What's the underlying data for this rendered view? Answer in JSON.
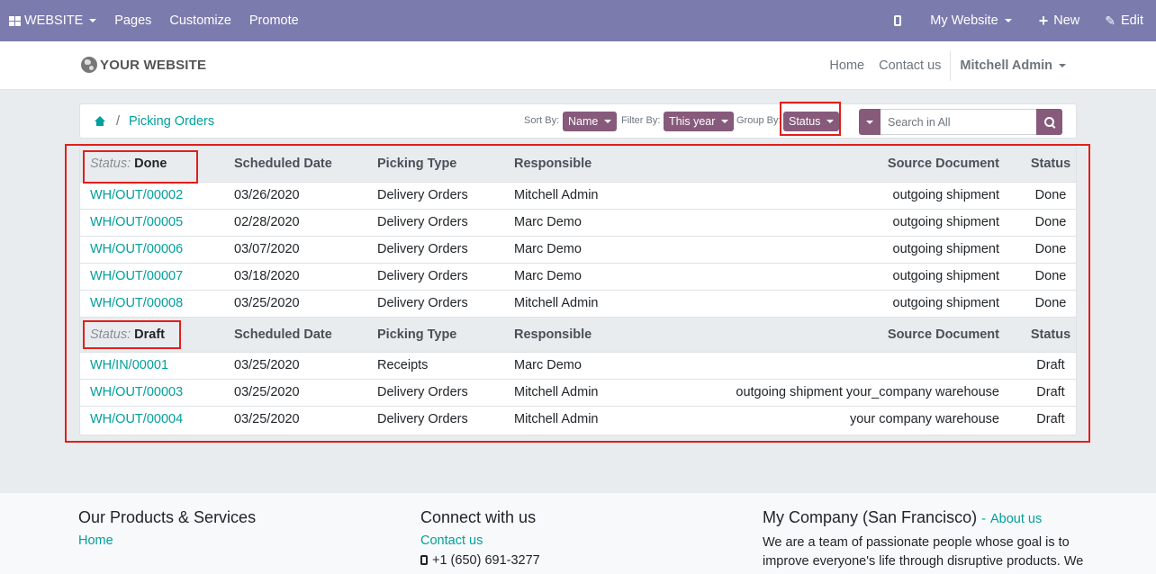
{
  "topbar": {
    "website_label": "WEBSITE",
    "pages_label": "Pages",
    "customize_label": "Customize",
    "promote_label": "Promote",
    "my_website_label": "My Website",
    "new_label": "New",
    "edit_label": "Edit",
    "bg_color": "#7c7bad"
  },
  "header": {
    "logo_text": "YOUR WEBSITE",
    "nav": [
      "Home",
      "Contact us"
    ],
    "user_label": "Mitchell Admin"
  },
  "breadcrumb": {
    "current": "Picking Orders"
  },
  "controls": {
    "sort_label": "Sort By:",
    "sort_value": "Name",
    "filter_label": "Filter By:",
    "filter_value": "This year",
    "group_label": "Group By:",
    "group_value": "Status",
    "search_placeholder": "Search in All",
    "accent_color": "#875a7b"
  },
  "table": {
    "columns": [
      "Scheduled Date",
      "Picking Type",
      "Responsible",
      "Source Document",
      "Status"
    ],
    "groups": [
      {
        "label": "Status:",
        "value": "Done",
        "rows": [
          {
            "ref": "WH/OUT/00002",
            "date": "03/26/2020",
            "type": "Delivery Orders",
            "responsible": "Mitchell Admin",
            "source": "outgoing shipment",
            "status": "Done"
          },
          {
            "ref": "WH/OUT/00005",
            "date": "02/28/2020",
            "type": "Delivery Orders",
            "responsible": "Marc Demo",
            "source": "outgoing shipment",
            "status": "Done"
          },
          {
            "ref": "WH/OUT/00006",
            "date": "03/07/2020",
            "type": "Delivery Orders",
            "responsible": "Marc Demo",
            "source": "outgoing shipment",
            "status": "Done"
          },
          {
            "ref": "WH/OUT/00007",
            "date": "03/18/2020",
            "type": "Delivery Orders",
            "responsible": "Marc Demo",
            "source": "outgoing shipment",
            "status": "Done"
          },
          {
            "ref": "WH/OUT/00008",
            "date": "03/25/2020",
            "type": "Delivery Orders",
            "responsible": "Mitchell Admin",
            "source": "outgoing shipment",
            "status": "Done"
          }
        ]
      },
      {
        "label": "Status:",
        "value": "Draft",
        "rows": [
          {
            "ref": "WH/IN/00001",
            "date": "03/25/2020",
            "type": "Receipts",
            "responsible": "Marc Demo",
            "source": "",
            "status": "Draft"
          },
          {
            "ref": "WH/OUT/00003",
            "date": "03/25/2020",
            "type": "Delivery Orders",
            "responsible": "Mitchell Admin",
            "source": "outgoing shipment your_company warehouse",
            "status": "Draft"
          },
          {
            "ref": "WH/OUT/00004",
            "date": "03/25/2020",
            "type": "Delivery Orders",
            "responsible": "Mitchell Admin",
            "source": "your company warehouse",
            "status": "Draft"
          }
        ]
      }
    ]
  },
  "footer": {
    "col1_title": "Our Products & Services",
    "col1_link": "Home",
    "col2_title": "Connect with us",
    "col2_link": "Contact us",
    "col2_phone": "+1 (650) 691-3277",
    "col3_title": "My Company (San Francisco)",
    "col3_dash": "-",
    "col3_link": "About us",
    "col3_text_line1": "We are a team of passionate people whose goal is to",
    "col3_text_line2": "improve everyone's life through disruptive products. We"
  },
  "link_color": "#00a09d",
  "highlight_color": "#e0201a"
}
